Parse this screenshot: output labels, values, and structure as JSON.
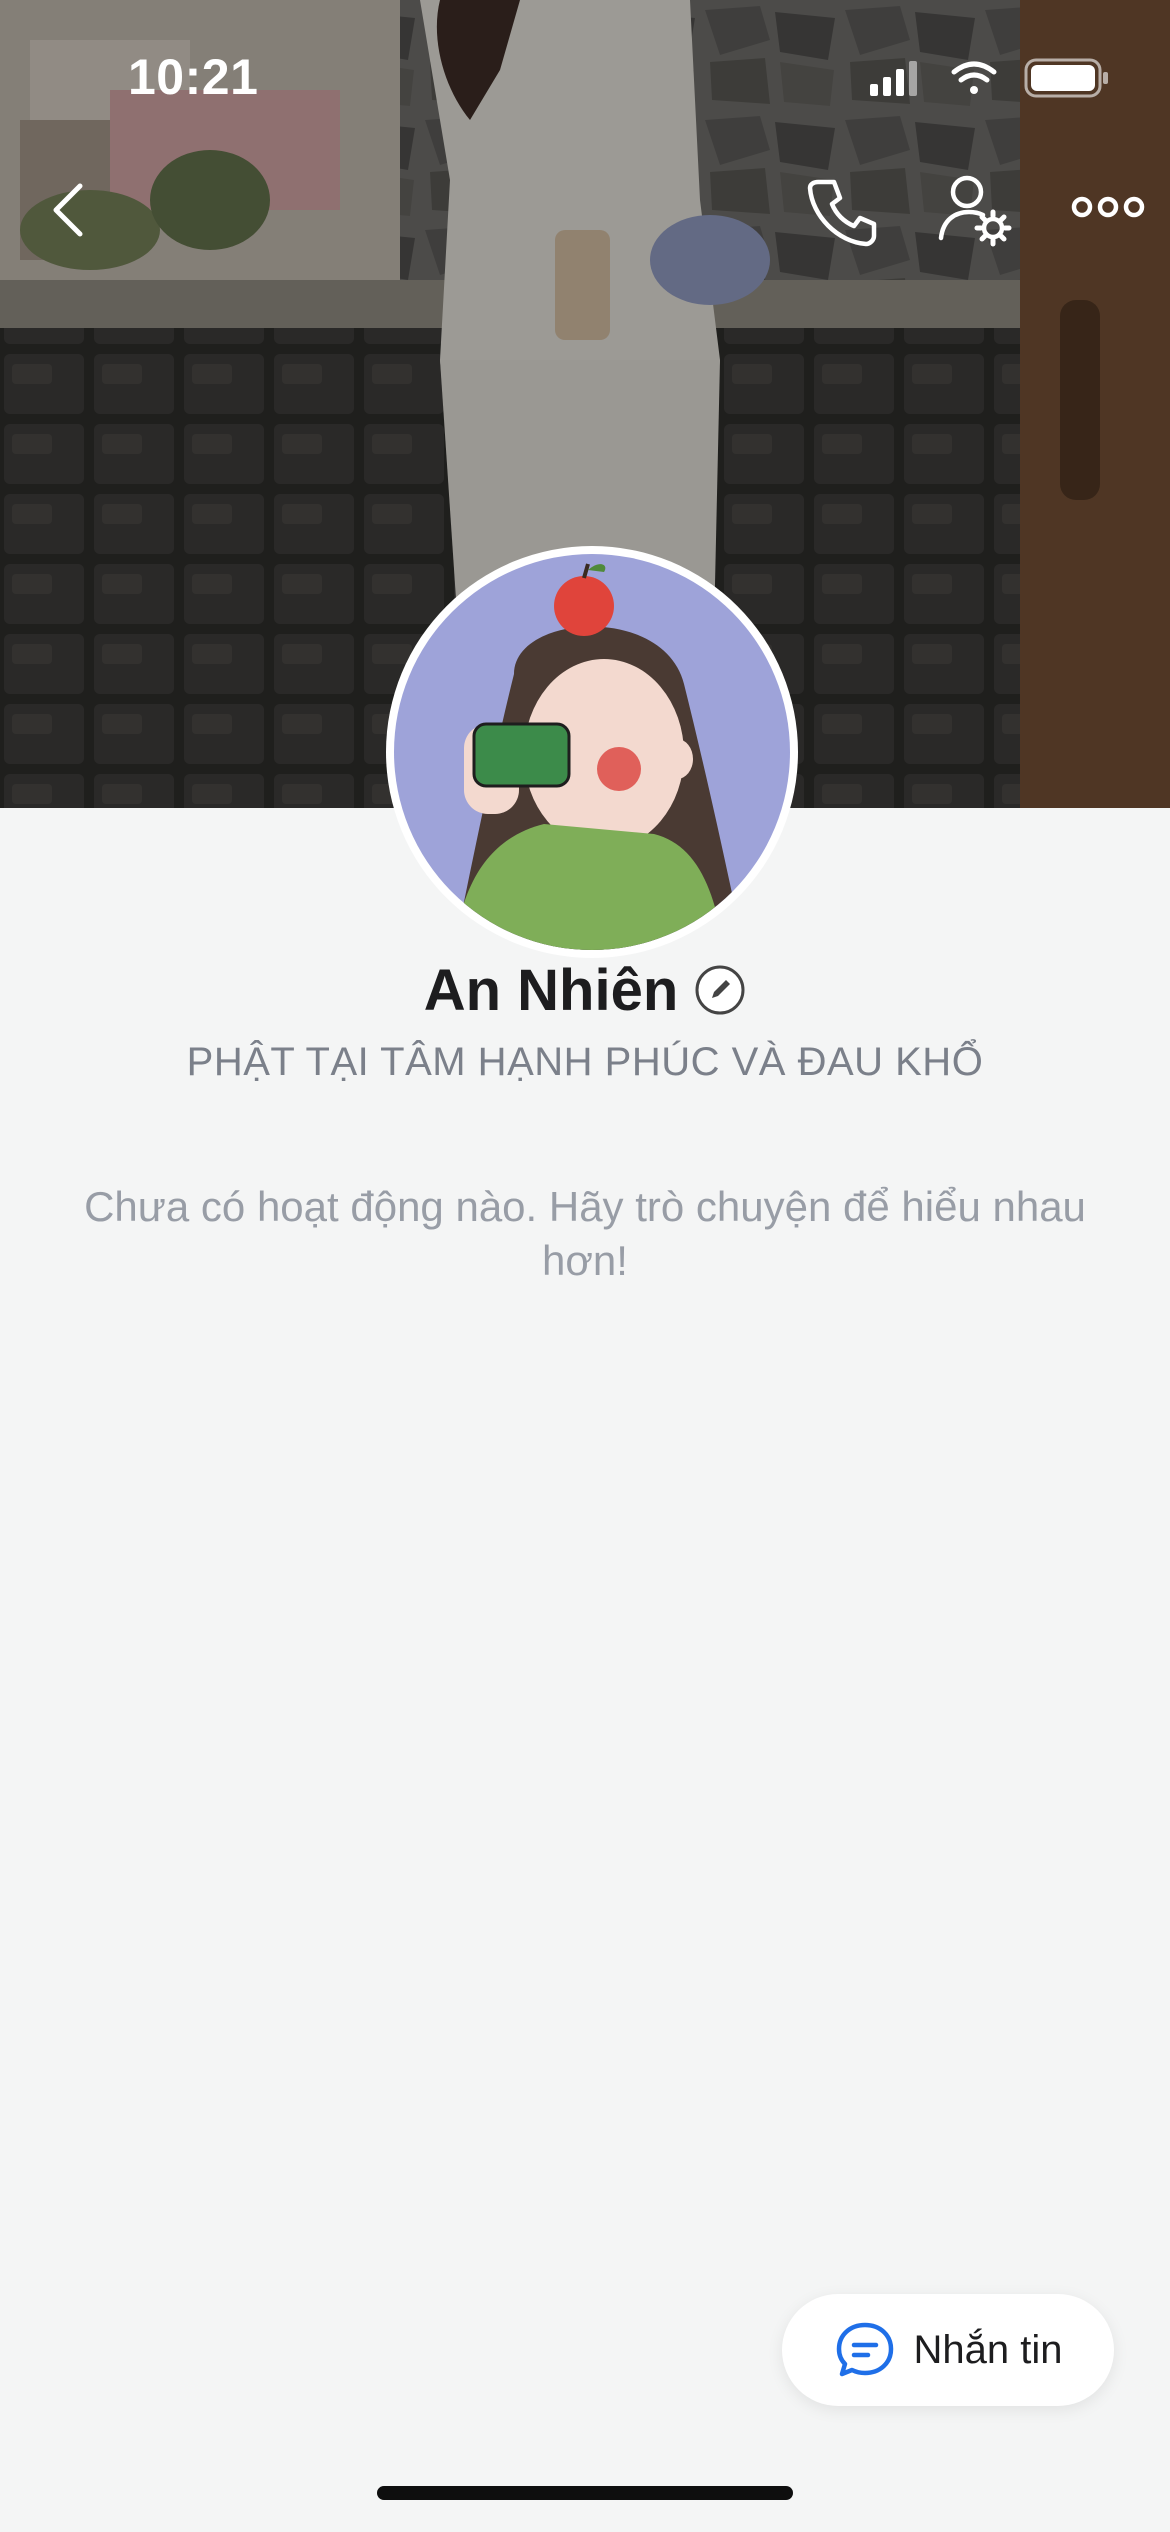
{
  "status_bar": {
    "time": "10:21"
  },
  "profile": {
    "name": "An Nhiên",
    "bio": "PHẬT TẠI TÂM HẠNH PHÚC VÀ ĐAU KHỔ",
    "empty_activity": "Chưa có hoạt động nào. Hãy trò chuyện để hiểu nhau hơn!"
  },
  "actions": {
    "message_label": "Nhắn tin"
  },
  "icons": {
    "back": "chevron-left-icon",
    "call": "phone-icon",
    "profile_settings": "user-gear-icon",
    "more": "more-horizontal-icon",
    "edit": "pencil-icon",
    "message": "chat-bubble-icon"
  },
  "colors": {
    "accent": "#1f6fe8",
    "background": "#f4f5f5"
  }
}
